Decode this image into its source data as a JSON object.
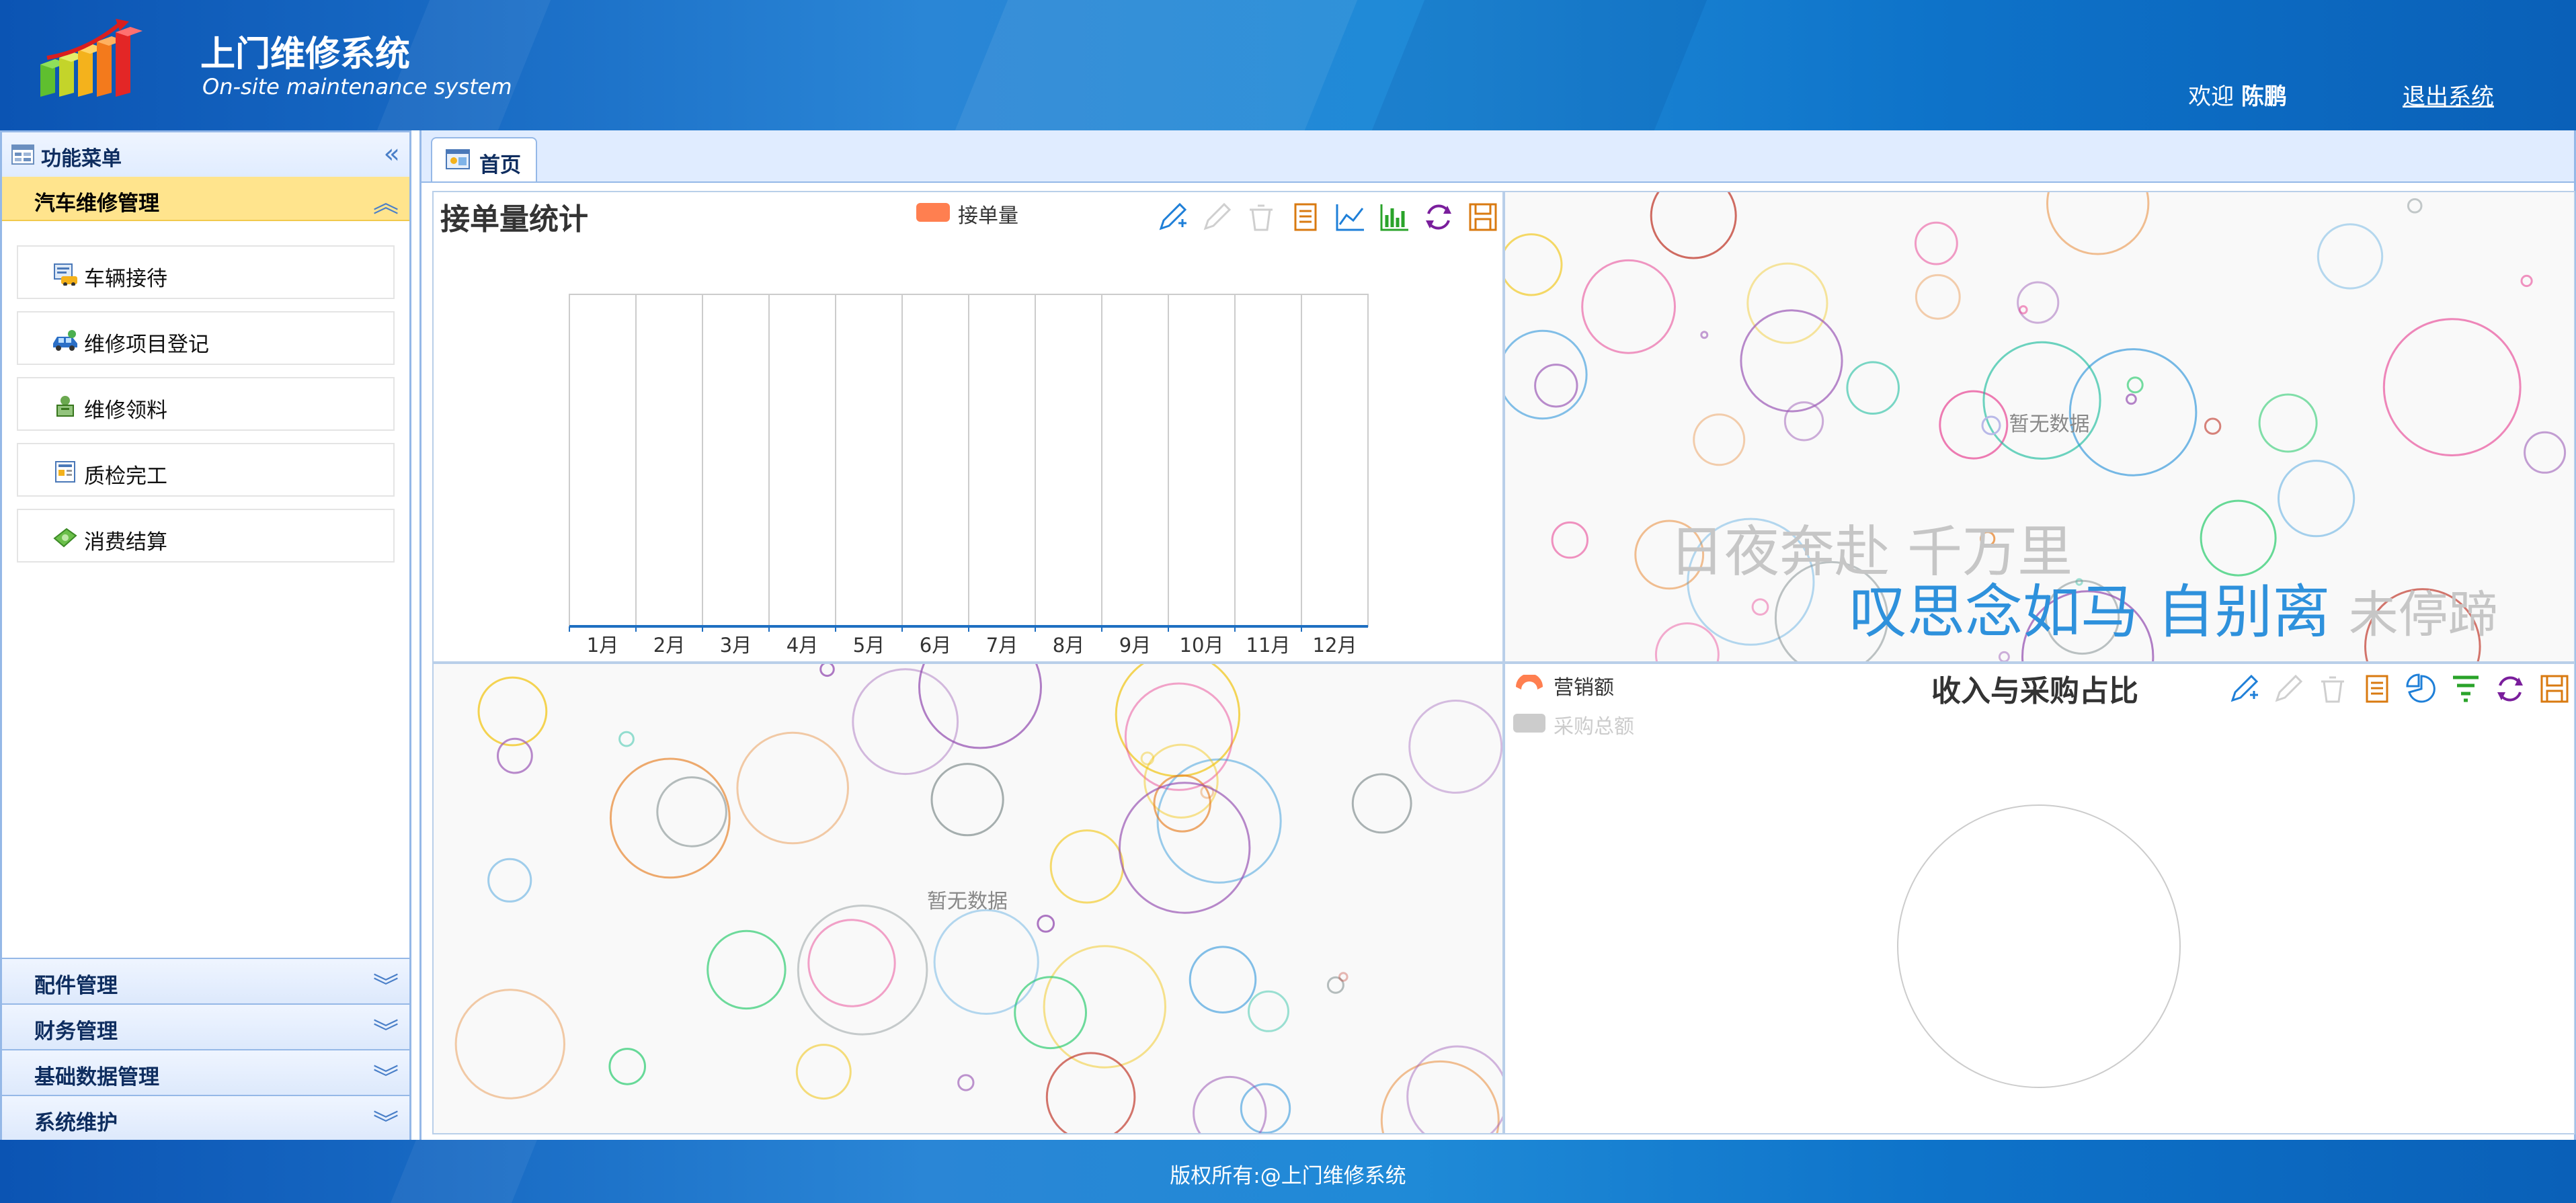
{
  "header": {
    "title": "上门维修系统",
    "subtitle": "On-site maintenance system",
    "welcome_prefix": "欢迎",
    "user_name": "陈鹏",
    "logout_label": "退出系统"
  },
  "sidebar": {
    "title": "功能菜单",
    "active_group": {
      "label": "汽车维修管理",
      "items": [
        {
          "label": "车辆接待",
          "icon": "car-reception-icon"
        },
        {
          "label": "维修项目登记",
          "icon": "car-repair-icon"
        },
        {
          "label": "维修领料",
          "icon": "material-pickup-icon"
        },
        {
          "label": "质检完工",
          "icon": "quality-check-icon"
        },
        {
          "label": "消费结算",
          "icon": "money-icon"
        }
      ]
    },
    "groups": [
      {
        "label": "配件管理"
      },
      {
        "label": "财务管理"
      },
      {
        "label": "基础数据管理"
      },
      {
        "label": "系统维护"
      }
    ]
  },
  "tabs": [
    {
      "label": "首页",
      "icon": "home-tab-icon"
    }
  ],
  "panels": {
    "order_chart": {
      "title": "接单量统计",
      "legend": "接单量",
      "toolbar_icons": [
        "mark-icon",
        "edit-disabled-icon",
        "clear-disabled-icon",
        "data-view-icon",
        "line-chart-icon",
        "bar-chart-icon",
        "restore-icon",
        "save-image-icon"
      ]
    },
    "empty_top": {
      "nodata": "暂无数据",
      "poem_line1": "日夜奔赴 千万里",
      "poem_line2_blue": "叹思念如马 自别离",
      "poem_line2_gray": "未停蹄"
    },
    "empty_bottom": {
      "nodata": "暂无数据"
    },
    "ratio_chart": {
      "title": "收入与采购占比",
      "legend": [
        "营销额",
        "采购总额"
      ],
      "toolbar_icons": [
        "mark-icon",
        "edit-disabled-icon",
        "clear-disabled-icon",
        "data-view-icon",
        "pie-chart-icon",
        "funnel-icon",
        "restore-icon",
        "save-image-icon"
      ]
    }
  },
  "chart_data": [
    {
      "type": "bar",
      "title": "接单量统计",
      "categories": [
        "1月",
        "2月",
        "3月",
        "4月",
        "5月",
        "6月",
        "7月",
        "8月",
        "9月",
        "10月",
        "11月",
        "12月"
      ],
      "series": [
        {
          "name": "接单量",
          "values": [
            0,
            0,
            0,
            0,
            0,
            0,
            0,
            0,
            0,
            0,
            0,
            0
          ]
        }
      ],
      "grid": true,
      "legend_position": "top-center",
      "colors": {
        "series": "#ff7f50",
        "axis": "#1f6fc1"
      }
    },
    {
      "type": "pie",
      "title": "收入与采购占比",
      "series": [
        {
          "name": "营销额",
          "values": []
        },
        {
          "name": "采购总额",
          "values": []
        }
      ],
      "legend_position": "top-left",
      "colors": {
        "active": "#ff7f50",
        "inactive": "#cccccc"
      }
    }
  ],
  "footer": {
    "copyright": "版权所有:@上门维修系统"
  },
  "colors": {
    "header_blue": "#1565c0",
    "accent_yellow": "#ffe48d",
    "border_blue": "#95b8e7",
    "poem_blue": "#2e91dc"
  }
}
